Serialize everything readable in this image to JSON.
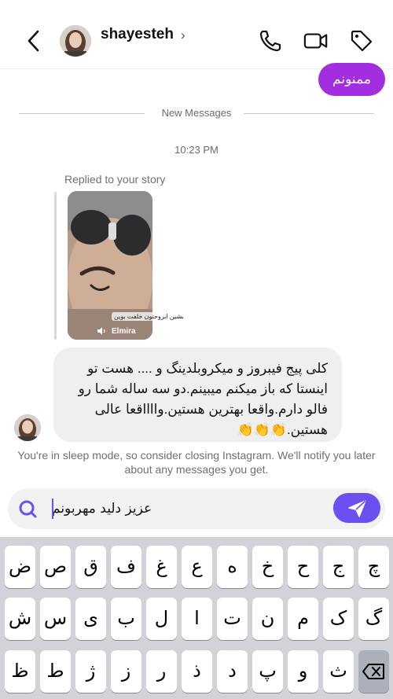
{
  "header": {
    "contact_name": "shayesteh",
    "chevron": "›",
    "icons": [
      "back-icon",
      "phone-icon",
      "video-icon",
      "tag-icon"
    ]
  },
  "messages": {
    "sent_text": "ممنونم",
    "new_messages_label": "New Messages",
    "timestamp": "10:23 PM",
    "replied_label": "Replied to your story",
    "story_watermark": "بشین ابروحتون خلفت بوین",
    "story_brand": "Elmira",
    "received_text": "کلی پیج فیبروز و میکروبلدینگ و .... هست تو اینستا که باز میکنم میبینم.دو سه ساله شما رو فالو دارم.واقعا بهترین هستین.وااااقعا عالی هستین.👏👏👏"
  },
  "sleep_note": "You're in sleep mode, so consider closing Instagram. We'll notify you later about any messages you get.",
  "composer": {
    "input_value": "عزیز دلید مهربونم",
    "search_icon": "search-icon",
    "send_icon": "send-icon"
  },
  "keyboard": {
    "row1": [
      "ض",
      "ص",
      "ق",
      "ف",
      "غ",
      "ع",
      "ه",
      "خ",
      "ح",
      "ج",
      "چ"
    ],
    "row2": [
      "ش",
      "س",
      "ی",
      "ب",
      "ل",
      "ا",
      "ت",
      "ن",
      "م",
      "ک",
      "گ"
    ],
    "row3": [
      "ظ",
      "ط",
      "ژ",
      "ز",
      "ر",
      "ذ",
      "د",
      "پ",
      "و",
      "ث"
    ],
    "delete_icon": "delete-key-icon"
  },
  "colors": {
    "sent_bubble": "#a32ee0",
    "accent": "#6b4ff0",
    "received_bubble": "#efefef",
    "keyboard_bg": "#d1d3d9"
  }
}
